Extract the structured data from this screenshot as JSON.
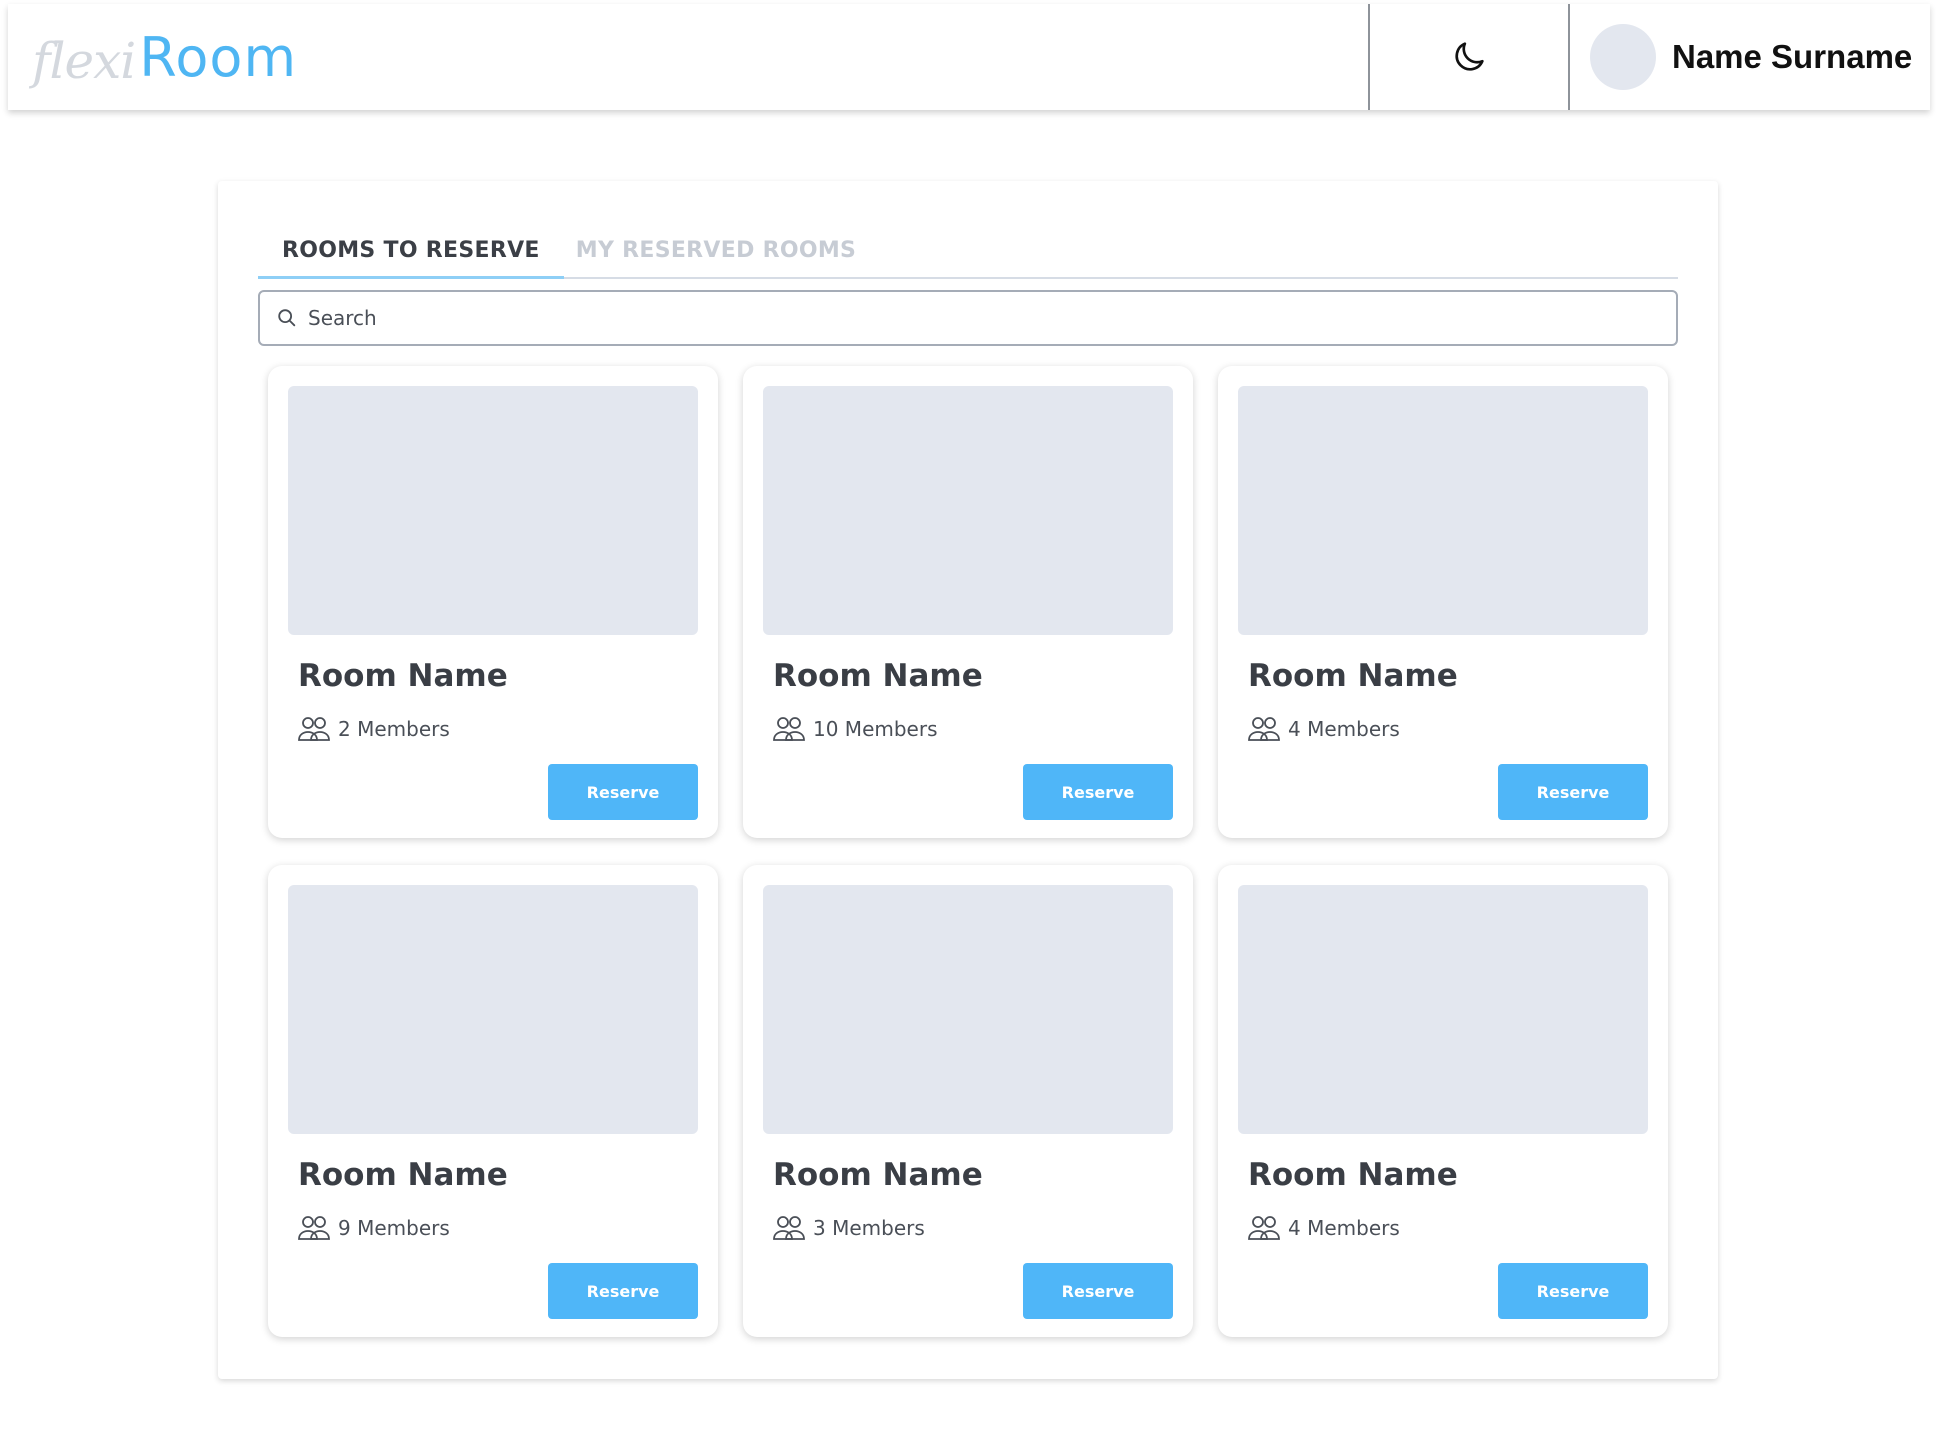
{
  "header": {
    "logo_prefix": "flexi",
    "logo_main": "Room",
    "theme_icon": "moon-icon",
    "user_name": "Name Surname"
  },
  "tabs": [
    {
      "label": "ROOMS TO RESERVE",
      "active": true
    },
    {
      "label": "MY RESERVED ROOMS",
      "active": false
    }
  ],
  "search": {
    "placeholder": "Search",
    "value": ""
  },
  "rooms": [
    {
      "name": "Room Name",
      "members": "2 Members",
      "button": "Reserve"
    },
    {
      "name": "Room Name",
      "members": "10 Members",
      "button": "Reserve"
    },
    {
      "name": "Room Name",
      "members": "4 Members",
      "button": "Reserve"
    },
    {
      "name": "Room Name",
      "members": "9 Members",
      "button": "Reserve"
    },
    {
      "name": "Room Name",
      "members": "3 Members",
      "button": "Reserve"
    },
    {
      "name": "Room Name",
      "members": "4 Members",
      "button": "Reserve"
    }
  ],
  "colors": {
    "accent": "#4fb6f8",
    "placeholder_image": "#e3e7ef",
    "active_tab_underline": "#8ecff6"
  }
}
